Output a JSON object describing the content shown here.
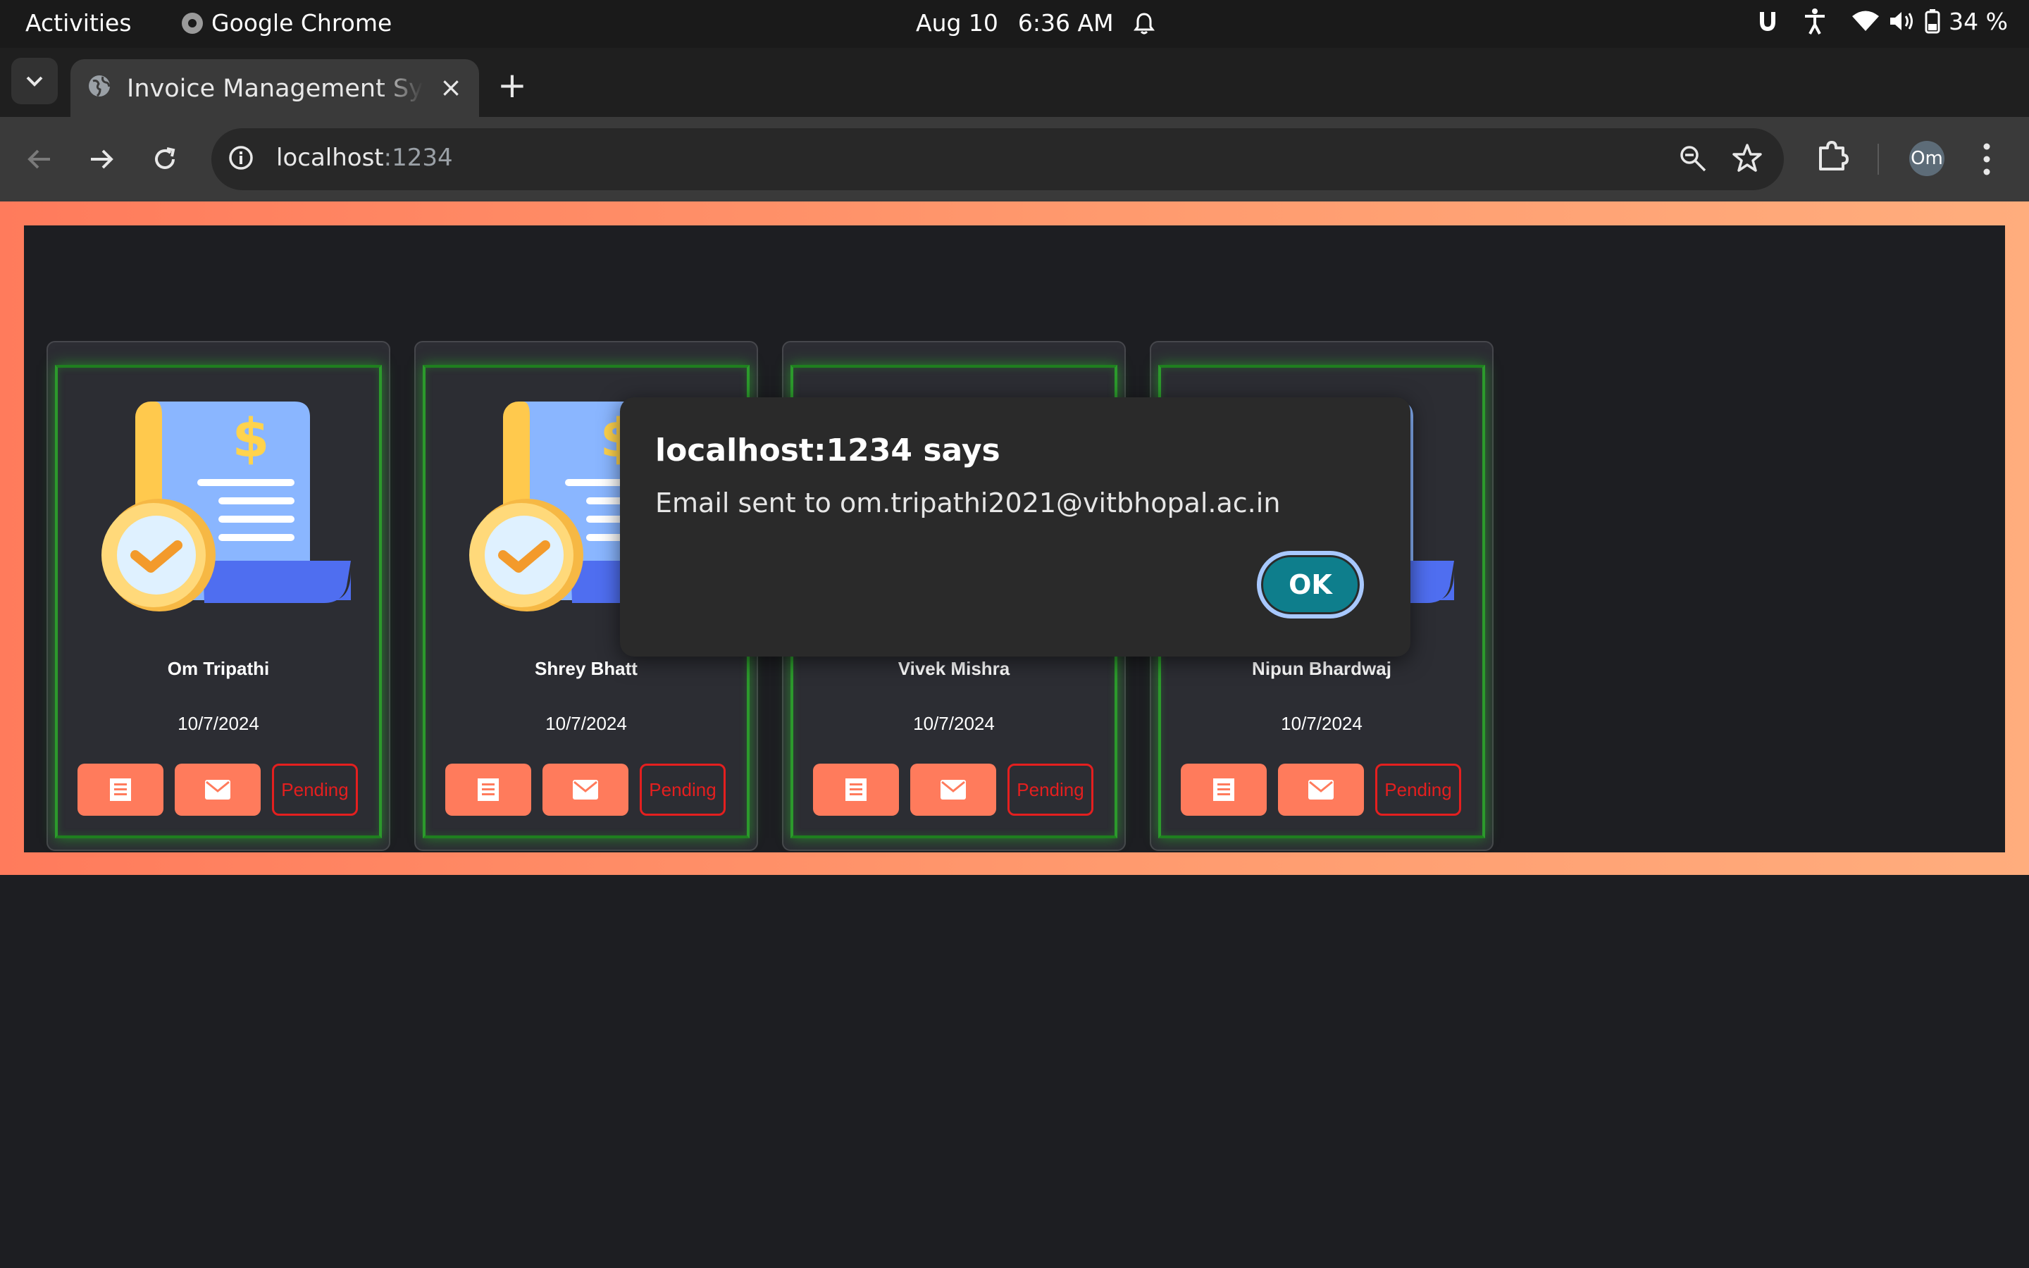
{
  "system_bar": {
    "activities": "Activities",
    "app_name": "Google Chrome",
    "date": "Aug 10",
    "time": "6:36 AM",
    "battery": "34 %"
  },
  "browser": {
    "tab_title": "Invoice Management System",
    "tab_close": "×",
    "new_tab": "+",
    "url_host": "localhost",
    "url_port": ":1234",
    "profile_initials": "Om"
  },
  "cards": [
    {
      "name": "Om Tripathi",
      "date": "10/7/2024",
      "status": "Pending"
    },
    {
      "name": "Shrey Bhatt",
      "date": "10/7/2024",
      "status": "Pending"
    },
    {
      "name": "Vivek Mishra",
      "date": "10/7/2024",
      "status": "Pending"
    },
    {
      "name": "Nipun Bhardwaj",
      "date": "10/7/2024",
      "status": "Pending"
    }
  ],
  "dialog": {
    "title": "localhost:1234 says",
    "message": "Email sent to om.tripathi2021@vitbhopal.ac.in",
    "ok_label": "OK"
  },
  "colors": {
    "accent": "#ff7b5c",
    "status_pending": "#e41f1f",
    "card_glow": "#2c9a2c",
    "dialog_ok": "#0e7e8c"
  }
}
